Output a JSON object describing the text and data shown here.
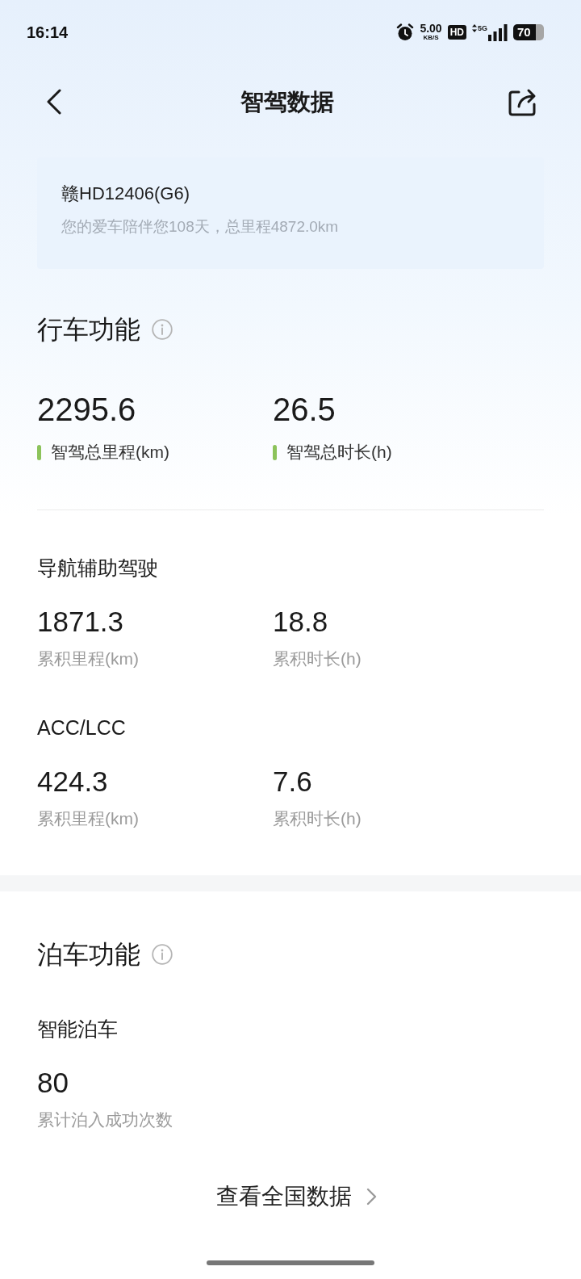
{
  "status_bar": {
    "time": "16:14",
    "net_speed": "5.00",
    "net_unit": "KB/S",
    "hd": "HD",
    "network": "5G",
    "battery": "70"
  },
  "header": {
    "title": "智驾数据"
  },
  "vehicle": {
    "plate": "赣HD12406(G6)",
    "summary": "您的爱车陪伴您108天，总里程4872.0km"
  },
  "sections": [
    {
      "title": "行车功能",
      "totals": [
        {
          "value": "2295.6",
          "label": "智驾总里程(km)"
        },
        {
          "value": "26.5",
          "label": "智驾总时长(h)"
        }
      ],
      "groups": [
        {
          "title": "导航辅助驾驶",
          "stats": [
            {
              "value": "1871.3",
              "label": "累积里程(km)"
            },
            {
              "value": "18.8",
              "label": "累积时长(h)"
            }
          ]
        },
        {
          "title": "ACC/LCC",
          "stats": [
            {
              "value": "424.3",
              "label": "累积里程(km)"
            },
            {
              "value": "7.6",
              "label": "累积时长(h)"
            }
          ]
        }
      ]
    },
    {
      "title": "泊车功能",
      "groups": [
        {
          "title": "智能泊车",
          "stats": [
            {
              "value": "80",
              "label": "累计泊入成功次数"
            }
          ]
        }
      ]
    }
  ],
  "footer_link": {
    "label": "查看全国数据"
  }
}
